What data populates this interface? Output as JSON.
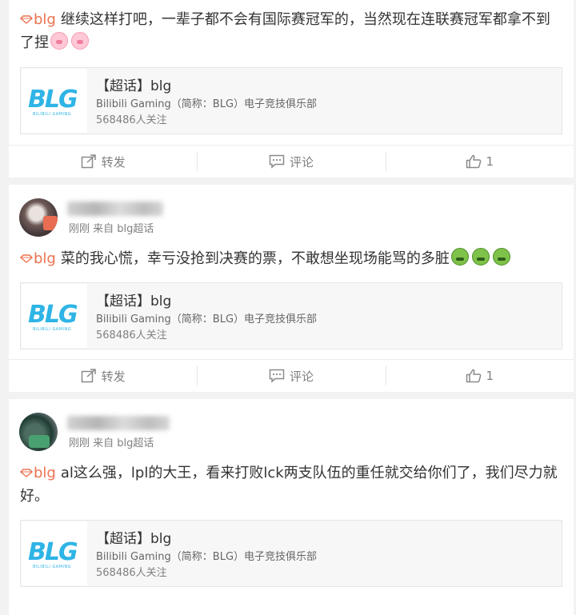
{
  "posts": [
    {
      "topic": "blg",
      "text": "继续这样打吧，一辈子都不会有国际赛冠军的，当然现在连联赛冠军都拿不到了捏",
      "topic_card": {
        "title": "【超话】blg",
        "desc": "Bilibili Gaming（简称：BLG）电子竞技俱乐部",
        "followers": "568486人关注"
      },
      "actions": {
        "repost": "转发",
        "comment": "评论",
        "like_count": "1"
      }
    },
    {
      "meta": "刚刚 来自 blg超话",
      "topic": "blg",
      "text": "菜的我心慌，幸亏没抢到决赛的票，不敢想坐现场能骂的多脏",
      "topic_card": {
        "title": "【超话】blg",
        "desc": "Bilibili Gaming（简称：BLG）电子竞技俱乐部",
        "followers": "568486人关注"
      },
      "actions": {
        "repost": "转发",
        "comment": "评论",
        "like_count": "1"
      }
    },
    {
      "meta": "刚刚 来自 blg超话",
      "topic": "blg",
      "text": "al这么强，lpl的大王，看来打败lck两支队伍的重任就交给你们了，我们尽力就好。",
      "topic_card": {
        "title": "【超话】blg",
        "desc": "Bilibili Gaming（简称：BLG）电子竞技俱乐部",
        "followers": "568486人关注"
      }
    }
  ],
  "logo": {
    "mark": "BLG",
    "sub": "BILIBILI GAMING"
  },
  "colors": {
    "topic": "#eb7350",
    "logo_blue": "#2fb4e6",
    "logo_pink": "#ef5a98"
  },
  "icons": [
    "diamond-icon",
    "pig-emoji-icon",
    "sick-emoji-icon",
    "repost-icon",
    "comment-icon",
    "like-icon"
  ]
}
